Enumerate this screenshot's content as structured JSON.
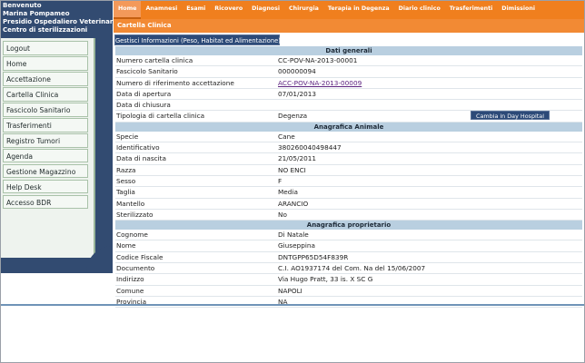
{
  "sidebar": {
    "welcome": [
      "Benvenuto",
      "Marina Pompameo",
      "Presidio Ospedaliero Veterinario",
      "Centro di sterilizzazioni"
    ],
    "items": [
      "Logout",
      "Home",
      "Accettazione",
      "Cartella Clinica",
      "Fascicolo Sanitario",
      "Trasferimenti",
      "Registro Tumori",
      "Agenda",
      "Gestione Magazzino",
      "Help Desk",
      "Accesso BDR"
    ]
  },
  "top_menu": [
    "Home",
    "Anamnesi",
    "Esami",
    "Ricovero",
    "Diagnosi",
    "Chirurgia",
    "Terapia in Degenza",
    "Diario clinico",
    "Trasferimenti",
    "Dimissioni"
  ],
  "page_title": "Cartella Clinica",
  "manage_button": "Gestisci Informazioni (Peso, Habitat ed Alimentazione)",
  "sections": [
    {
      "title": "Dati generali",
      "rows": [
        {
          "label": "Numero cartella clinica",
          "value": "CC-POV-NA-2013-00001"
        },
        {
          "label": "Fascicolo Sanitario",
          "value": "000000094"
        },
        {
          "label": "Numero di riferimento accettazione",
          "value": "ACC-POV-NA-2013-00009"
        },
        {
          "label": "Data di apertura",
          "value": "07/01/2013"
        },
        {
          "label": "Data di chiusura",
          "value": ""
        },
        {
          "label": "Tipologia di cartella clinica",
          "value": "Degenza"
        }
      ]
    },
    {
      "title": "Anagrafica Animale",
      "rows": [
        {
          "label": "Specie",
          "value": "Cane"
        },
        {
          "label": "Identificativo",
          "value": "380260040498447"
        },
        {
          "label": "Data di nascita",
          "value": "21/05/2011"
        },
        {
          "label": "Razza",
          "value": "NO ENCI"
        },
        {
          "label": "Sesso",
          "value": "F"
        },
        {
          "label": "Taglia",
          "value": "Media"
        },
        {
          "label": "Mantello",
          "value": "ARANCIO"
        },
        {
          "label": "Sterilizzato",
          "value": "No"
        }
      ]
    },
    {
      "title": "Anagrafica proprietario",
      "rows": [
        {
          "label": "Cognome",
          "value": "Di Natale"
        },
        {
          "label": "Nome",
          "value": "Giuseppina"
        },
        {
          "label": "Codice Fiscale",
          "value": "DNTGPP65D54F839R"
        },
        {
          "label": "Documento",
          "value": "C.I. AO1937174 del Com. Na del 15/06/2007"
        },
        {
          "label": "Indirizzo",
          "value": "Via Hugo Pratt, 33 is. X SC G"
        },
        {
          "label": "Comune",
          "value": "NAPOLI"
        },
        {
          "label": "Provincia",
          "value": "NA"
        }
      ]
    }
  ],
  "day_hospital_button": "Cambia in Day Hospital",
  "colors": {
    "accent": "#f07f1e",
    "sidebar": "#324b71",
    "section_header": "#b9cfe0",
    "link": "#5e2480"
  }
}
